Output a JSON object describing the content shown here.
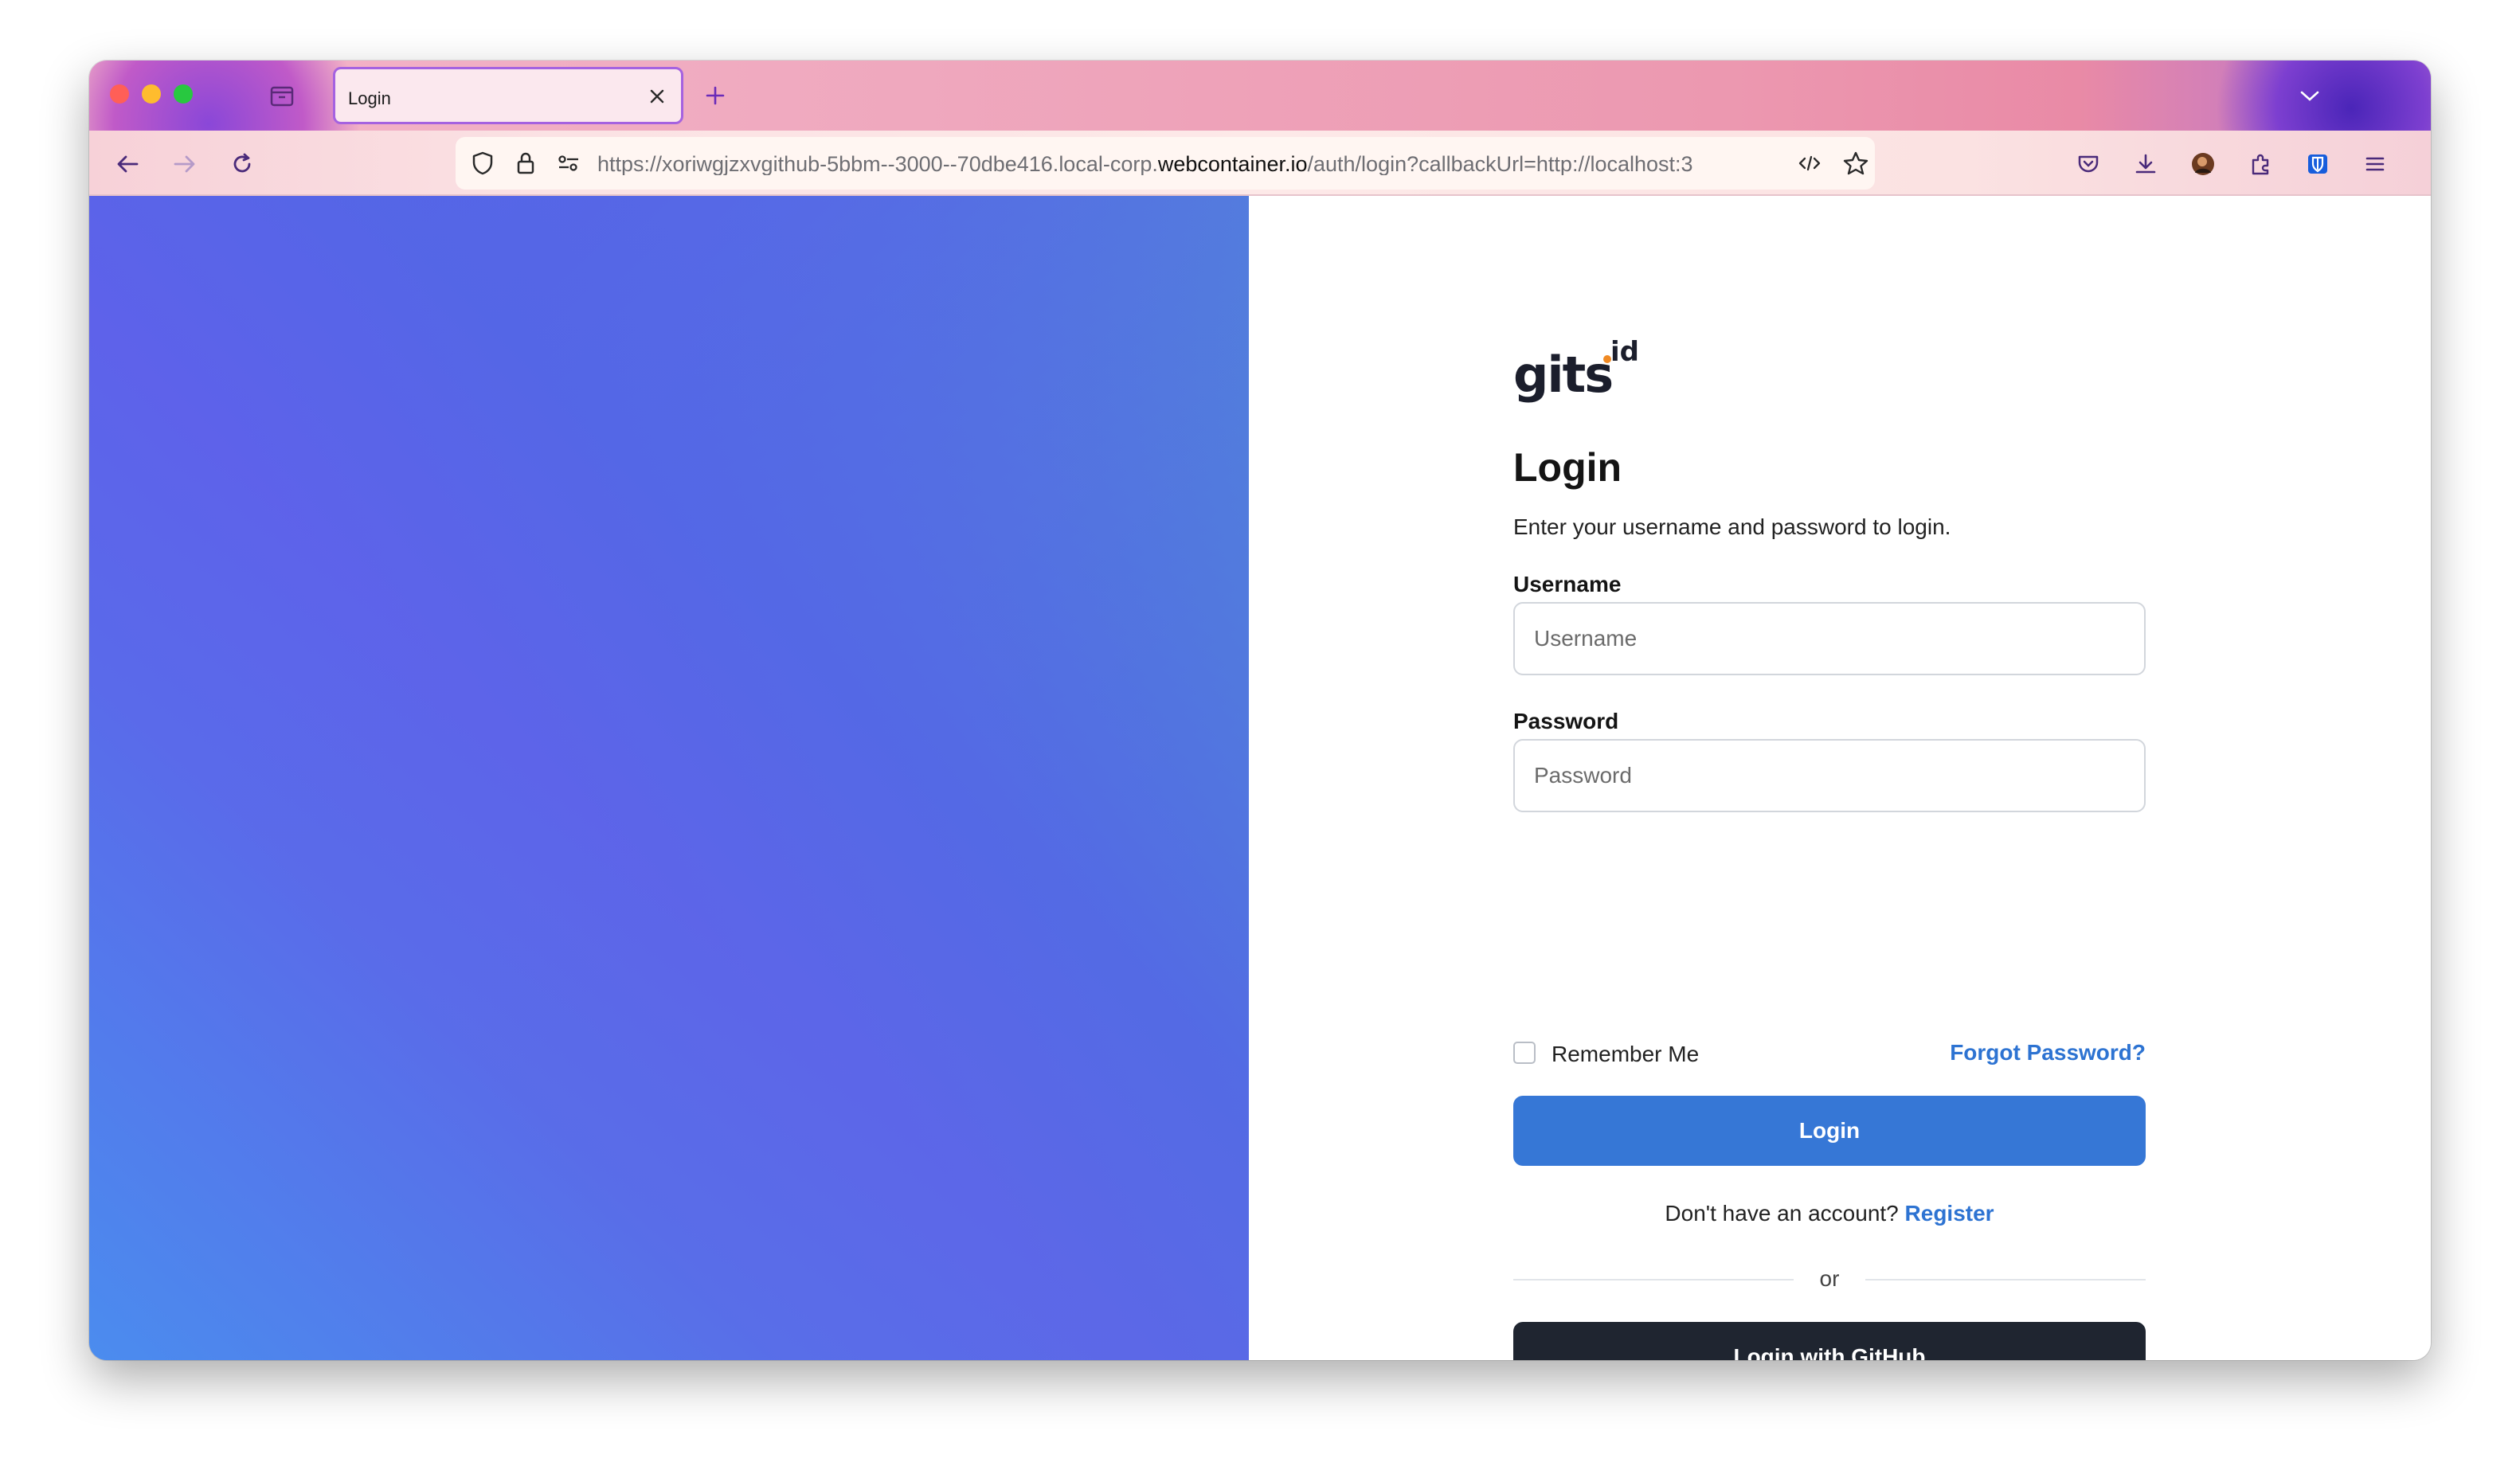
{
  "browser": {
    "tab_title": "Login",
    "url_prefix": "https://xoriwgjzxvgithub-5bbm--3000--70dbe416.local-corp.",
    "url_domain": "webcontainer.io",
    "url_suffix": "/auth/login?callbackUrl=http://localhost:3"
  },
  "logo": {
    "main": "gits",
    "sup": "id",
    "dot_color": "#f08a24"
  },
  "form": {
    "title": "Login",
    "subtitle": "Enter your username and password to login.",
    "username_label": "Username",
    "username_placeholder": "Username",
    "password_label": "Password",
    "password_placeholder": "Password",
    "remember_label": "Remember Me",
    "forgot_label": "Forgot Password?",
    "login_button": "Login",
    "no_account_text": "Don't have an account?",
    "register_link": "Register",
    "or_text": "or",
    "github_button": "Login with GitHub"
  },
  "colors": {
    "primary": "#3677d6",
    "link": "#2d73d2",
    "dark_button": "#1f2530"
  }
}
